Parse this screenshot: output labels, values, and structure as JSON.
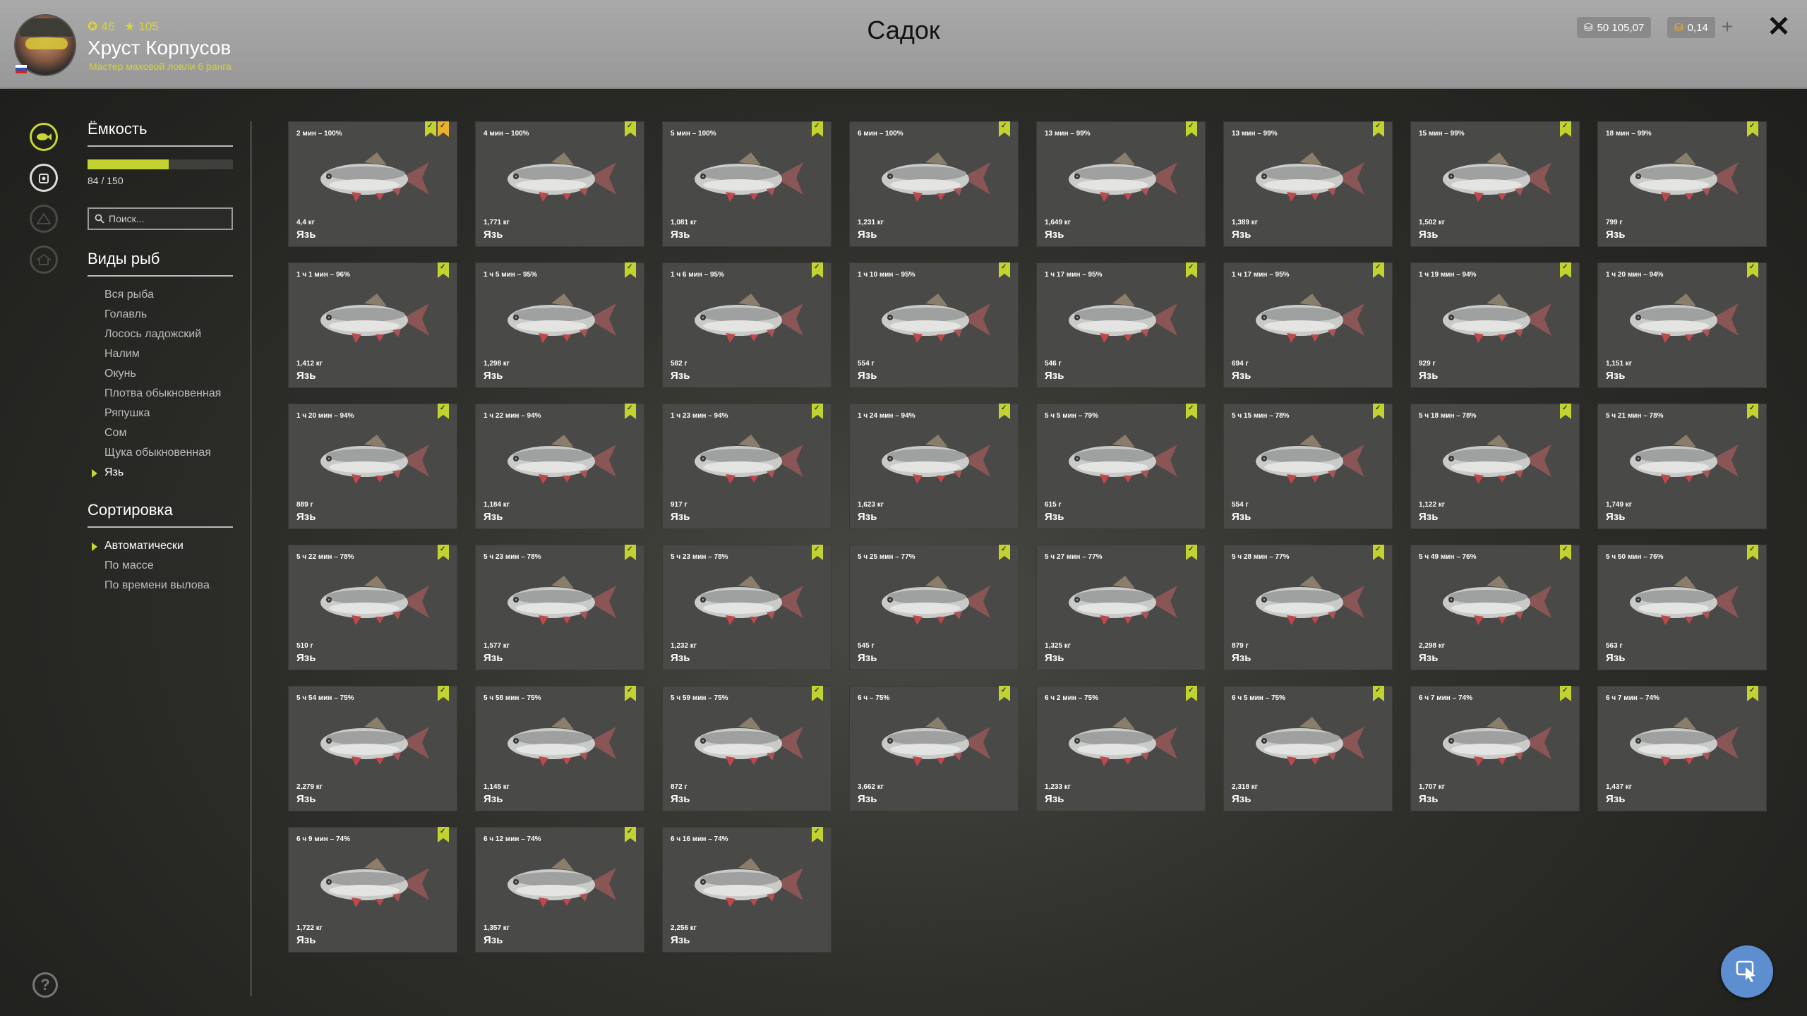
{
  "header": {
    "title": "Садок",
    "player_name": "Хруст Корпусов",
    "player_rank": "Мастер маховой ловли 6 ранга",
    "level": "46",
    "stars": "105",
    "silver": "50 105,07",
    "gold": "0,14"
  },
  "sidebar": {
    "capacity_title": "Ёмкость",
    "capacity_text": "84 / 150",
    "capacity_fraction": 0.56,
    "search_placeholder": "Поиск...",
    "species_title": "Виды рыб",
    "species": [
      "Вся рыба",
      "Голавль",
      "Лосось ладожский",
      "Налим",
      "Окунь",
      "Плотва обыкновенная",
      "Ряпушка",
      "Сом",
      "Щука обыкновенная",
      "Язь"
    ],
    "species_selected_index": 9,
    "sort_title": "Сортировка",
    "sort_options": [
      "Автоматически",
      "По массе",
      "По времени вылова"
    ],
    "sort_selected_index": 0
  },
  "fish": [
    {
      "time": "2 мин – 100%",
      "weight": "4,4 кг",
      "name": "Язь",
      "marks": 2
    },
    {
      "time": "4 мин – 100%",
      "weight": "1,771 кг",
      "name": "Язь",
      "marks": 1
    },
    {
      "time": "5 мин – 100%",
      "weight": "1,081 кг",
      "name": "Язь",
      "marks": 1
    },
    {
      "time": "6 мин – 100%",
      "weight": "1,231 кг",
      "name": "Язь",
      "marks": 1
    },
    {
      "time": "13 мин – 99%",
      "weight": "1,649 кг",
      "name": "Язь",
      "marks": 1
    },
    {
      "time": "13 мин – 99%",
      "weight": "1,389 кг",
      "name": "Язь",
      "marks": 1
    },
    {
      "time": "15 мин – 99%",
      "weight": "1,502 кг",
      "name": "Язь",
      "marks": 1
    },
    {
      "time": "18 мин – 99%",
      "weight": "799 г",
      "name": "Язь",
      "marks": 1
    },
    {
      "time": "1 ч 1 мин – 96%",
      "weight": "1,412 кг",
      "name": "Язь",
      "marks": 1
    },
    {
      "time": "1 ч 5 мин – 95%",
      "weight": "1,298 кг",
      "name": "Язь",
      "marks": 1
    },
    {
      "time": "1 ч 6 мин – 95%",
      "weight": "582 г",
      "name": "Язь",
      "marks": 1
    },
    {
      "time": "1 ч 10 мин – 95%",
      "weight": "554 г",
      "name": "Язь",
      "marks": 1
    },
    {
      "time": "1 ч 17 мин – 95%",
      "weight": "546 г",
      "name": "Язь",
      "marks": 1
    },
    {
      "time": "1 ч 17 мин – 95%",
      "weight": "694 г",
      "name": "Язь",
      "marks": 1
    },
    {
      "time": "1 ч 19 мин – 94%",
      "weight": "929 г",
      "name": "Язь",
      "marks": 1
    },
    {
      "time": "1 ч 20 мин – 94%",
      "weight": "1,151 кг",
      "name": "Язь",
      "marks": 1
    },
    {
      "time": "1 ч 20 мин – 94%",
      "weight": "889 г",
      "name": "Язь",
      "marks": 1
    },
    {
      "time": "1 ч 22 мин – 94%",
      "weight": "1,184 кг",
      "name": "Язь",
      "marks": 1
    },
    {
      "time": "1 ч 23 мин – 94%",
      "weight": "917 г",
      "name": "Язь",
      "marks": 1
    },
    {
      "time": "1 ч 24 мин – 94%",
      "weight": "1,623 кг",
      "name": "Язь",
      "marks": 1
    },
    {
      "time": "5 ч 5 мин – 79%",
      "weight": "615 г",
      "name": "Язь",
      "marks": 1
    },
    {
      "time": "5 ч 15 мин – 78%",
      "weight": "554 г",
      "name": "Язь",
      "marks": 1
    },
    {
      "time": "5 ч 18 мин – 78%",
      "weight": "1,122 кг",
      "name": "Язь",
      "marks": 1
    },
    {
      "time": "5 ч 21 мин – 78%",
      "weight": "1,749 кг",
      "name": "Язь",
      "marks": 1
    },
    {
      "time": "5 ч 22 мин – 78%",
      "weight": "510 г",
      "name": "Язь",
      "marks": 1
    },
    {
      "time": "5 ч 23 мин – 78%",
      "weight": "1,577 кг",
      "name": "Язь",
      "marks": 1
    },
    {
      "time": "5 ч 23 мин – 78%",
      "weight": "1,232 кг",
      "name": "Язь",
      "marks": 1
    },
    {
      "time": "5 ч 25 мин – 77%",
      "weight": "545 г",
      "name": "Язь",
      "marks": 1
    },
    {
      "time": "5 ч 27 мин – 77%",
      "weight": "1,325 кг",
      "name": "Язь",
      "marks": 1
    },
    {
      "time": "5 ч 28 мин – 77%",
      "weight": "879 г",
      "name": "Язь",
      "marks": 1
    },
    {
      "time": "5 ч 49 мин – 76%",
      "weight": "2,298 кг",
      "name": "Язь",
      "marks": 1
    },
    {
      "time": "5 ч 50 мин – 76%",
      "weight": "563 г",
      "name": "Язь",
      "marks": 1
    },
    {
      "time": "5 ч 54 мин – 75%",
      "weight": "2,279 кг",
      "name": "Язь",
      "marks": 1
    },
    {
      "time": "5 ч 58 мин – 75%",
      "weight": "1,145 кг",
      "name": "Язь",
      "marks": 1
    },
    {
      "time": "5 ч 59 мин – 75%",
      "weight": "872 г",
      "name": "Язь",
      "marks": 1
    },
    {
      "time": "6 ч – 75%",
      "weight": "3,662 кг",
      "name": "Язь",
      "marks": 1
    },
    {
      "time": "6 ч 2 мин – 75%",
      "weight": "1,233 кг",
      "name": "Язь",
      "marks": 1
    },
    {
      "time": "6 ч 5 мин – 75%",
      "weight": "2,318 кг",
      "name": "Язь",
      "marks": 1
    },
    {
      "time": "6 ч 7 мин – 74%",
      "weight": "1,707 кг",
      "name": "Язь",
      "marks": 1
    },
    {
      "time": "6 ч 7 мин – 74%",
      "weight": "1,437 кг",
      "name": "Язь",
      "marks": 1
    },
    {
      "time": "6 ч 9 мин – 74%",
      "weight": "1,722 кг",
      "name": "Язь",
      "marks": 1
    },
    {
      "time": "6 ч 12 мин – 74%",
      "weight": "1,357 кг",
      "name": "Язь",
      "marks": 1
    },
    {
      "time": "6 ч 16 мин – 74%",
      "weight": "2,256 кг",
      "name": "Язь",
      "marks": 1
    }
  ],
  "colors": {
    "accent": "#c2d22e",
    "fab": "#5d8fd0"
  },
  "icons": {
    "close": "close-icon",
    "help": "help-icon",
    "search": "search-icon",
    "fab": "cursor-icon"
  }
}
